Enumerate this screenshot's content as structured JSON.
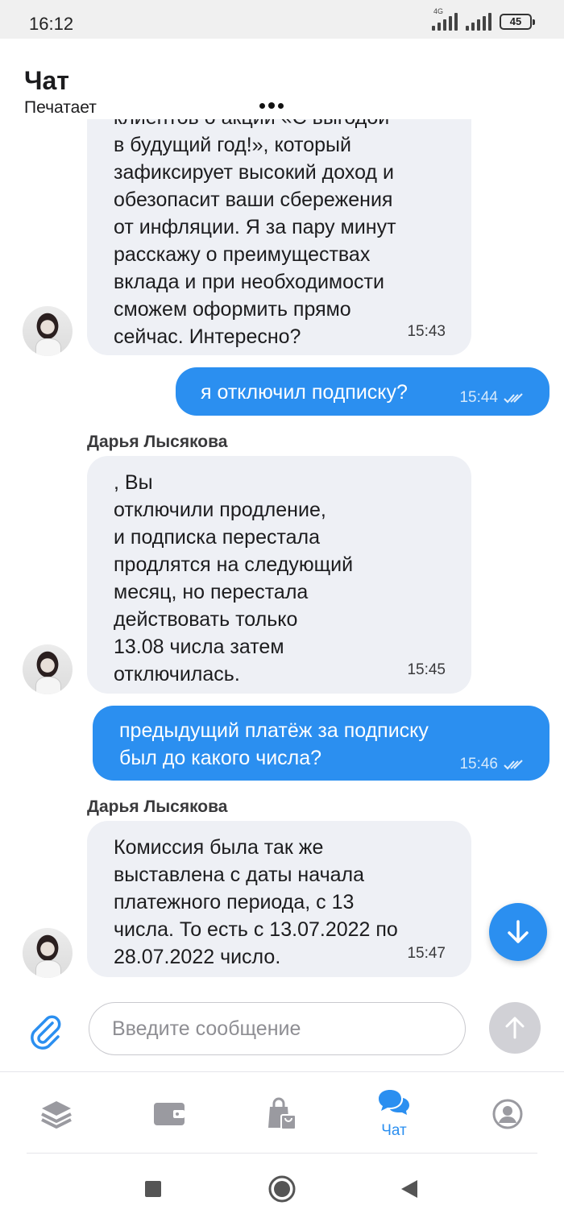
{
  "status_bar": {
    "time": "16:12",
    "network": "4G",
    "battery": "45"
  },
  "header": {
    "title": "Чат",
    "subtitle": "Печатает"
  },
  "messages": [
    {
      "direction": "in",
      "text": "клиентов о акции «С выгодой\nв будущий год!», который\nзафиксирует высокий доход и\nобезопасит ваши сбережения\nот инфляции. Я за пару минут\nрасскажу о преимуществах\nвклада и при необходимости\nсможем оформить прямо\nсейчас. Интересно?",
      "time": "15:43"
    },
    {
      "direction": "out",
      "text": "я отключил подписку?",
      "time": "15:44",
      "status": "read"
    },
    {
      "direction": "in",
      "sender": "Дарья Лысякова",
      "text": "                                   , Вы\nотключили продление,\nи подписка перестала\nпродлятся на следующий\nмесяц, но перестала\nдействовать только\n13.08 числа затем\nотключилась.",
      "time": "15:45"
    },
    {
      "direction": "out",
      "text": "предыдущий платёж за подписку\nбыл до какого числа?",
      "time": "15:46",
      "status": "read"
    },
    {
      "direction": "in",
      "sender": "Дарья Лысякова",
      "text": "Комиссия была так же\nвыставлена с даты начала\nплатежного периода, с 13\nчисла. То есть с 13.07.2022 по\n28.07.2022 число.",
      "time": "15:47"
    }
  ],
  "composer": {
    "placeholder": "Введите сообщение",
    "value": ""
  },
  "bottom_nav": {
    "items": [
      {
        "icon": "layers-icon",
        "label": "",
        "active": false
      },
      {
        "icon": "wallet-icon",
        "label": "",
        "active": false
      },
      {
        "icon": "shopping-bag-icon",
        "label": "",
        "active": false
      },
      {
        "icon": "chat-bubbles-icon",
        "label": "Чат",
        "active": true
      },
      {
        "icon": "profile-icon",
        "label": "",
        "active": false
      }
    ]
  },
  "colors": {
    "accent": "#2b8ff0",
    "incoming_bubble": "#eef0f5",
    "inactive_icon": "#9a9aa0"
  }
}
